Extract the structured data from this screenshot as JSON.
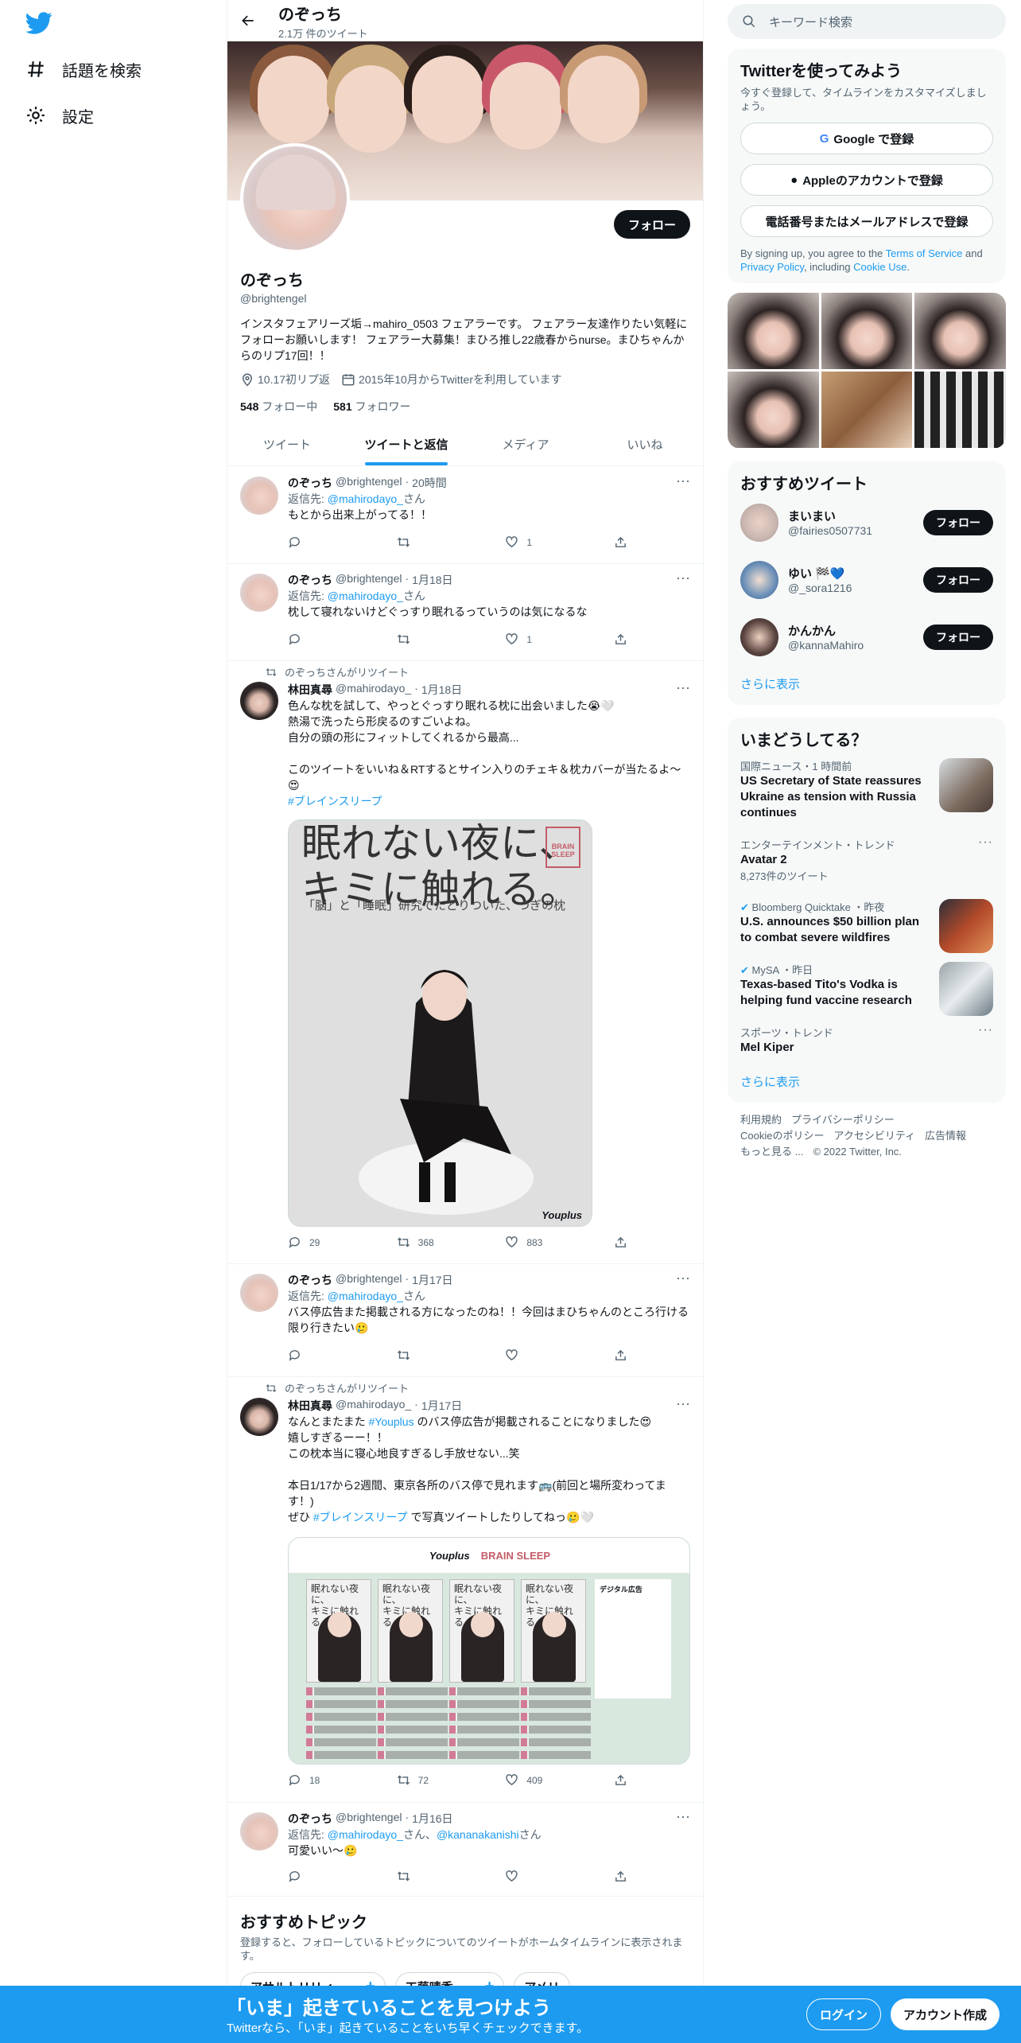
{
  "nav": {
    "explore": "話題を検索",
    "settings": "設定"
  },
  "header": {
    "name": "のぞっち",
    "tweet_count": "2.1万 件のツイート"
  },
  "profile": {
    "name": "のぞっち",
    "handle": "@brightengel",
    "bio": "インスタフェアリーズ垢→mahiro_0503 フェアラーです。 フェアラー友達作りたい気軽にフォローお願いします！ フェアラー大募集！まひろ推し22歳春からnurse。まひちゃんからのリプ17回！！",
    "location": "10.17初リプ返",
    "joined": "2015年10月からTwitterを利用しています",
    "following_count": "548",
    "following_label": "フォロー中",
    "followers_count": "581",
    "followers_label": "フォロワー",
    "follow_button": "フォロー"
  },
  "tabs": [
    "ツイート",
    "ツイートと返信",
    "メディア",
    "いいね"
  ],
  "tweets": [
    {
      "name": "のぞっち",
      "handle": "@brightengel",
      "time": "20時間",
      "reply_prefix": "返信先: ",
      "reply_to": "@mahirodayo_",
      "reply_suffix": "さん",
      "text": "もとから出来上がってる！！",
      "likes": "1"
    },
    {
      "name": "のぞっち",
      "handle": "@brightengel",
      "time": "1月18日",
      "reply_prefix": "返信先: ",
      "reply_to": "@mahirodayo_",
      "reply_suffix": "さん",
      "text": "枕して寝れないけどぐっすり眠れるっていうのは気になるな",
      "likes": "1"
    },
    {
      "retweeted_by": "のぞっちさんがリツイート",
      "name": "林田真尋",
      "handle": "@mahirodayo_",
      "time": "1月18日",
      "line1": "色んな枕を試して、やっとぐっすり眠れる枕に出会いました😭🤍",
      "line2": "熱湯で洗ったら形戻るのすごいよね。",
      "line3": "自分の頭の形にフィットしてくれるから最高...",
      "line4": "このツイートをいいね＆RTするとサイン入りのチェキ＆枕カバーが当たるよ〜😍",
      "hashtag": "#ブレインスリープ",
      "img_headline1": "眠れない夜に、",
      "img_headline2": "キミに触れる。",
      "img_sub": "「脳」と「睡眠」研究でたどりついた、つぎの枕",
      "img_logo": "BRAIN SLEEP",
      "img_brand": "Youplus",
      "replies": "29",
      "retweets": "368",
      "likes": "883"
    },
    {
      "name": "のぞっち",
      "handle": "@brightengel",
      "time": "1月17日",
      "reply_prefix": "返信先: ",
      "reply_to": "@mahirodayo_",
      "reply_suffix": "さん",
      "text": "バス停広告また掲載される方になったのね！！今回はまひちゃんのところ行ける限り行きたい🥲"
    },
    {
      "retweeted_by": "のぞっちさんがリツイート",
      "name": "林田真尋",
      "handle": "@mahirodayo_",
      "time": "1月17日",
      "line1_a": "なんとまたまた ",
      "line1_tag": "#Youplus",
      "line1_b": " のバス停広告が掲載されることになりました😍",
      "line2": "嬉しすぎるーー！！",
      "line3": "この枕本当に寝心地良すぎるし手放せない...笑",
      "line4": "本日1/17から2週間、東京各所のバス停で見れます🚌(前回と場所変わってます！)",
      "line5_a": "ぜひ ",
      "line5_tag": "#ブレインスリープ",
      "line5_b": " で写真ツイートしたりしてねっ🥲🤍",
      "img_brand": "Youplus",
      "img_logo": "BRAIN SLEEP",
      "img_side_title": "デジタル広告",
      "replies": "18",
      "retweets": "72",
      "likes": "409"
    },
    {
      "name": "のぞっち",
      "handle": "@brightengel",
      "time": "1月16日",
      "reply_prefix": "返信先: ",
      "reply_to": "@mahirodayo_",
      "reply_mid": "さん、",
      "reply_to2": "@kananakanishi",
      "reply_suffix": "さん",
      "text": "可愛いい〜🥲"
    }
  ],
  "topics": {
    "title": "おすすめトピック",
    "desc": "登録すると、フォローしているトピックについてのツイートがホームタイムラインに表示されます。",
    "chips": [
      "アサルトリリィ",
      "工藤晴香",
      "アメリ"
    ]
  },
  "right": {
    "search_placeholder": "キーワード検索",
    "signup": {
      "title": "Twitterを使ってみよう",
      "desc": "今すぐ登録して、タイムラインをカスタマイズしましょう。",
      "google": "Google で登録",
      "apple": "Appleのアカウントで登録",
      "phone": "電話番号またはメールアドレスで登録",
      "terms_prefix": "By signing up, you agree to the ",
      "terms": "Terms of Service",
      "and": " and ",
      "privacy": "Privacy Policy",
      "including": ", including ",
      "cookie": "Cookie Use",
      "end": "."
    },
    "who": {
      "title": "おすすめツイート",
      "users": [
        {
          "name": "まいまい",
          "handle": "@fairies0507731",
          "color": "#c9b6b0"
        },
        {
          "name": "ゆい 🏁💙",
          "handle": "@_sora1216",
          "color": "#6a8fb8"
        },
        {
          "name": "かんかん",
          "handle": "@kannaMahiro",
          "color": "#5a4440"
        }
      ],
      "follow": "フォロー",
      "more": "さらに表示"
    },
    "trends": {
      "title": "いまどうしてる？",
      "items": [
        {
          "cat": "国際ニュース・1 時間前",
          "title": "US Secretary of State reassures Ukraine as tension with Russia continues"
        },
        {
          "cat": "エンターテインメント・トレンド",
          "title": "Avatar 2",
          "count": "8,273件のツイート"
        },
        {
          "cat": "Bloomberg Quicktake ・昨夜",
          "title": "U.S. announces $50 billion plan to combat severe wildfires"
        },
        {
          "cat": "MySA ・昨日",
          "title": "Texas-based Tito's Vodka is helping fund vaccine research"
        },
        {
          "cat": "スポーツ・トレンド",
          "title": "Mel Kiper"
        }
      ],
      "more": "さらに表示"
    },
    "footer": {
      "l1": [
        "利用規約",
        "プライバシーポリシー"
      ],
      "l2": [
        "Cookieのポリシー",
        "アクセシビリティ",
        "広告情報"
      ],
      "l3": [
        "もっと見る ...",
        "© 2022 Twitter, Inc."
      ]
    }
  },
  "bottom": {
    "headline": "「いま」起きていることを見つけよう",
    "sub": "Twitterなら、「いま」起きていることをいち早くチェックできます。",
    "login": "ログイン",
    "signup": "アカウント作成"
  }
}
